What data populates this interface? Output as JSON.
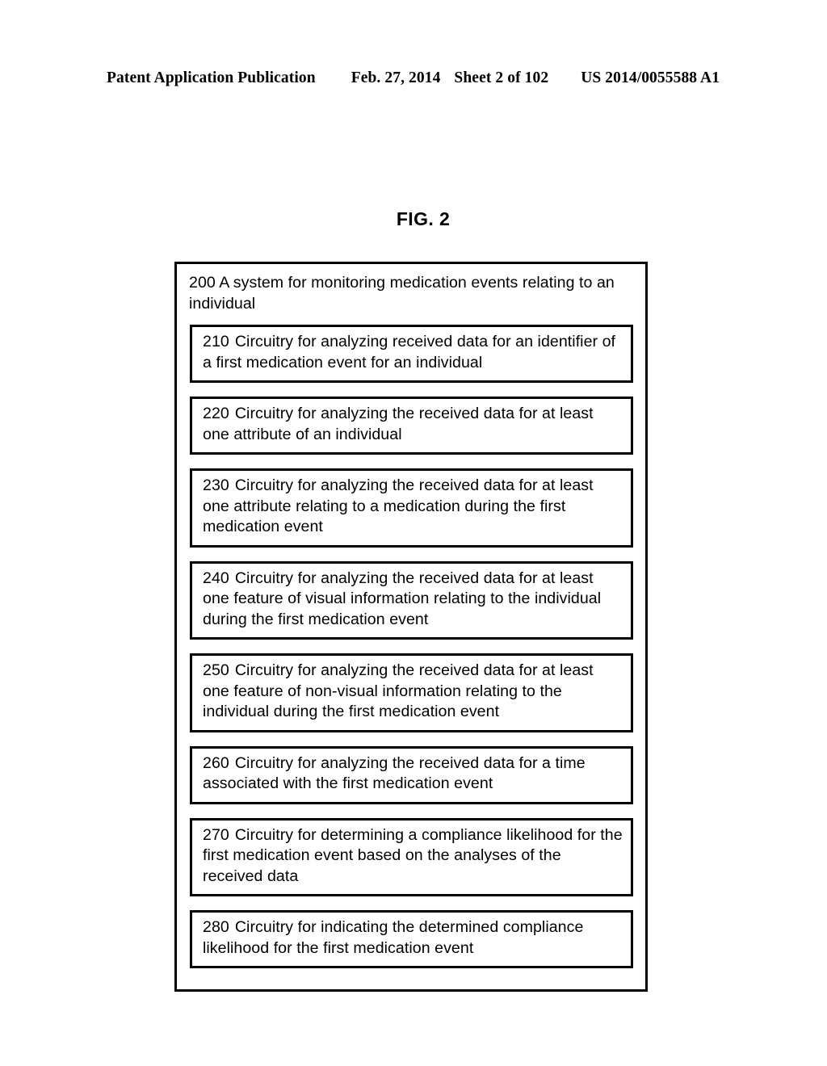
{
  "header": {
    "publication": "Patent Application Publication",
    "date": "Feb. 27, 2014",
    "sheet": "Sheet 2 of 102",
    "patent_number": "US 2014/0055588 A1"
  },
  "figure": {
    "label": "FIG. 2"
  },
  "system": {
    "number": "200",
    "title": "A system for monitoring medication events relating to an individual",
    "full_title": "200 A system for monitoring medication events relating to an individual",
    "blocks": [
      {
        "number": "210",
        "text": "Circuitry for analyzing received data for an identifier of a first medication event for an individual"
      },
      {
        "number": "220",
        "text": "Circuitry for analyzing the received data for at least one attribute of an individual"
      },
      {
        "number": "230",
        "text": "Circuitry for analyzing the received data for at least one attribute relating to a medication during the first medication event"
      },
      {
        "number": "240",
        "text": "Circuitry for analyzing the received data for at least one feature of visual information relating to the individual during the first medication event"
      },
      {
        "number": "250",
        "text": "Circuitry for analyzing the received data for at least one feature of non-visual information relating to the individual during the first medication event"
      },
      {
        "number": "260",
        "text": "Circuitry for analyzing the received data for a time associated with the first medication event"
      },
      {
        "number": "270",
        "text": "Circuitry for determining a compliance likelihood for the first medication event based on the analyses of the received data"
      },
      {
        "number": "280",
        "text": "Circuitry for indicating the determined compliance likelihood for the first medication event"
      }
    ]
  }
}
